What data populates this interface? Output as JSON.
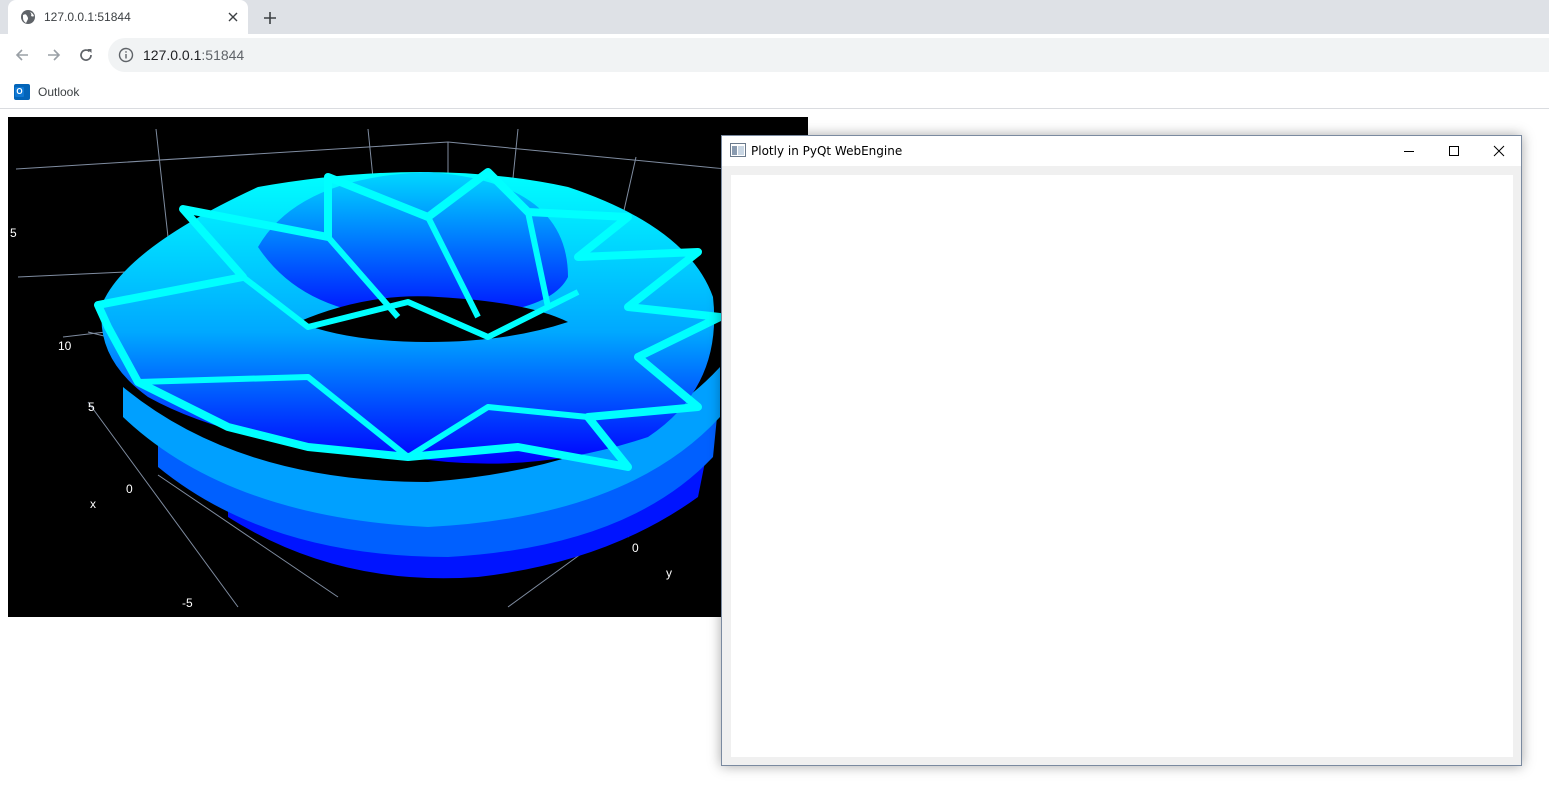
{
  "browser": {
    "tab": {
      "title": "127.0.0.1:51844",
      "favicon": "globe-icon"
    },
    "new_tab_icon": "plus-icon",
    "toolbar": {
      "back_icon": "arrow-left-icon",
      "forward_icon": "arrow-right-icon",
      "reload_icon": "reload-icon",
      "info_icon": "info-icon",
      "url_host": "127.0.0.1",
      "url_port": ":51844"
    },
    "bookmarks": [
      {
        "label": "Outlook",
        "icon": "outlook-icon"
      }
    ]
  },
  "plot": {
    "x_axis_title": "x",
    "y_axis_title": "y",
    "x_ticks": [
      "10",
      "5",
      "0",
      "-5"
    ],
    "y_ticks": [
      "0"
    ],
    "partial_tick": "5",
    "colors": {
      "background": "#000000",
      "surface_light": "#00ffff",
      "surface_dark": "#0000ff",
      "grid": "#7f8ca0"
    }
  },
  "qt_window": {
    "title": "Plotly in PyQt WebEngine",
    "app_icon": "qt-app-icon",
    "minimize_icon": "minimize-icon",
    "maximize_icon": "maximize-icon",
    "close_icon": "close-icon"
  }
}
